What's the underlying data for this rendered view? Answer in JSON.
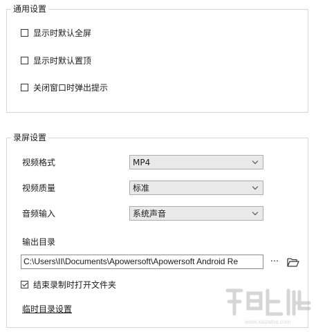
{
  "general_settings": {
    "title": "通用设置",
    "options": [
      {
        "label": "显示时默认全屏",
        "checked": false
      },
      {
        "label": "显示时默认置顶",
        "checked": false
      },
      {
        "label": "关闭窗口时弹出提示",
        "checked": false
      }
    ]
  },
  "record_settings": {
    "title": "录屏设置",
    "video_format": {
      "label": "视频格式",
      "value": "MP4"
    },
    "video_quality": {
      "label": "视频质量",
      "value": "标准"
    },
    "audio_input": {
      "label": "音频输入",
      "value": "系统声音"
    },
    "output_dir": {
      "label": "输出目录",
      "value": "C:\\Users\\II\\Documents\\Apowersoft\\Apowersoft Android Re",
      "more_label": "···"
    },
    "open_folder_option": {
      "label": "结束录制时打开文件夹",
      "checked": true
    },
    "temp_dir_link": "临时目录设置"
  },
  "icons": {
    "folder": "folder-open-icon",
    "chevron": "chevron-down-icon",
    "watermark": "watermark-logo"
  }
}
